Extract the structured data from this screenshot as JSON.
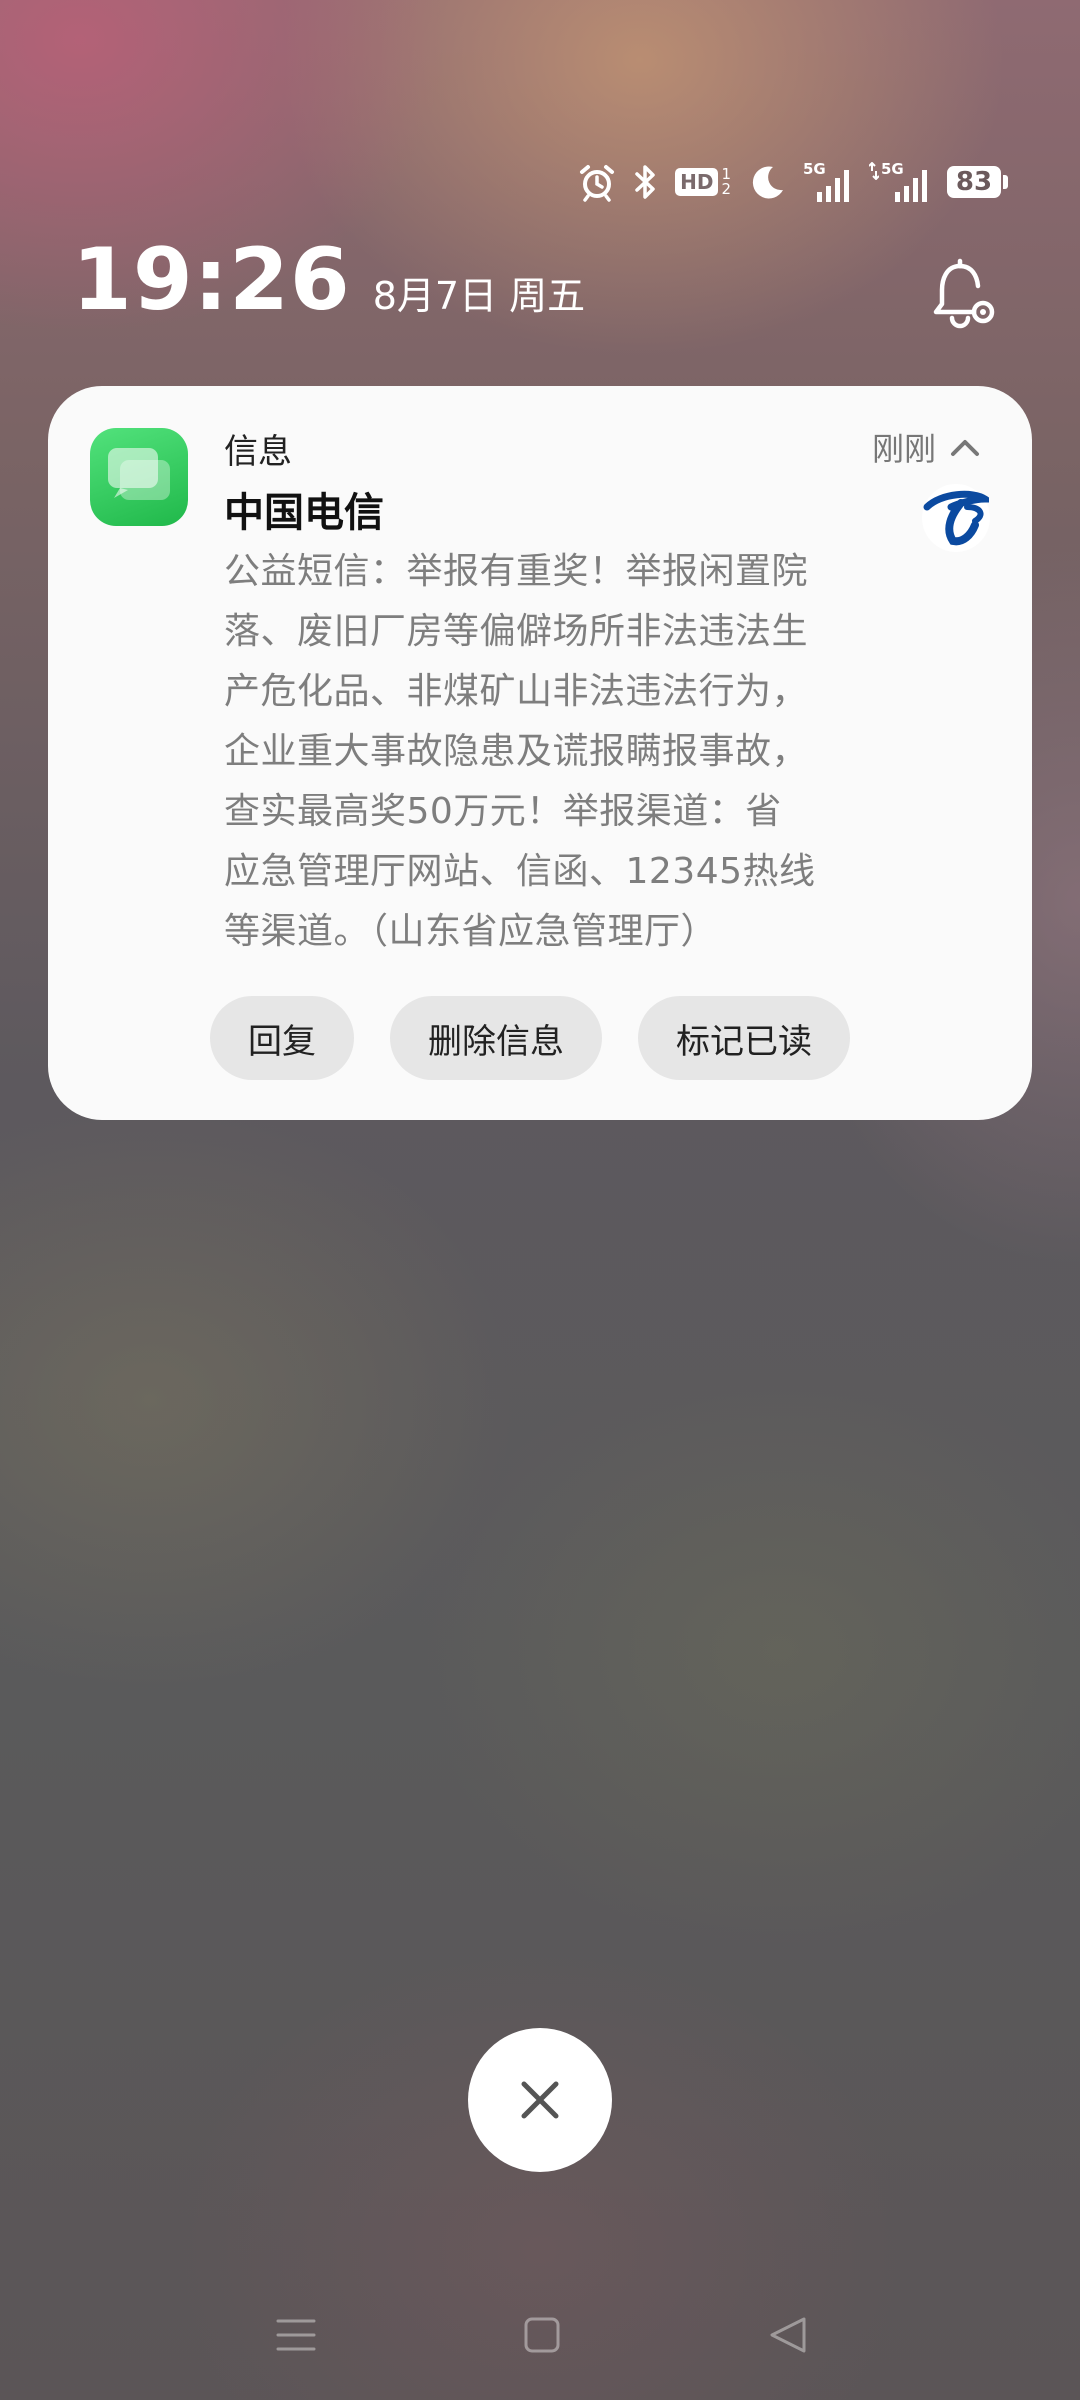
{
  "status_bar": {
    "icons": [
      "alarm-icon",
      "bluetooth-icon",
      "hd-voice-icon",
      "do-not-disturb-moon-icon",
      "signal-5g-icon",
      "signal-5g-icon"
    ],
    "hd_label": "HD",
    "hd_sim": [
      "1",
      "2"
    ],
    "sim1_label": "5G",
    "sim2_label": "5G",
    "battery": "83"
  },
  "clock": {
    "time": "19:26",
    "date": "8月7日 周五"
  },
  "notification": {
    "app_name": "信息",
    "time_ago": "刚刚",
    "sender": "中国电信",
    "body_lines": [
      "公益短信：举报有重奖！举报闲置院",
      "落、废旧厂房等偏僻场所非法违法生",
      "产危化品、非煤矿山非法违法行为，",
      "企业重大事故隐患及谎报瞒报事故，",
      "查实最高奖50万元！举报渠道：省",
      "应急管理厅网站、信函、12345热线",
      "等渠道。（山东省应急管理厅）"
    ],
    "actions": [
      "回复",
      "删除信息",
      "标记已读"
    ]
  },
  "colors": {
    "app_icon_green": "#2bc455",
    "telecom_blue": "#0b4aa0",
    "card_bg": "#fafafa",
    "action_bg": "#e6e6e6"
  }
}
